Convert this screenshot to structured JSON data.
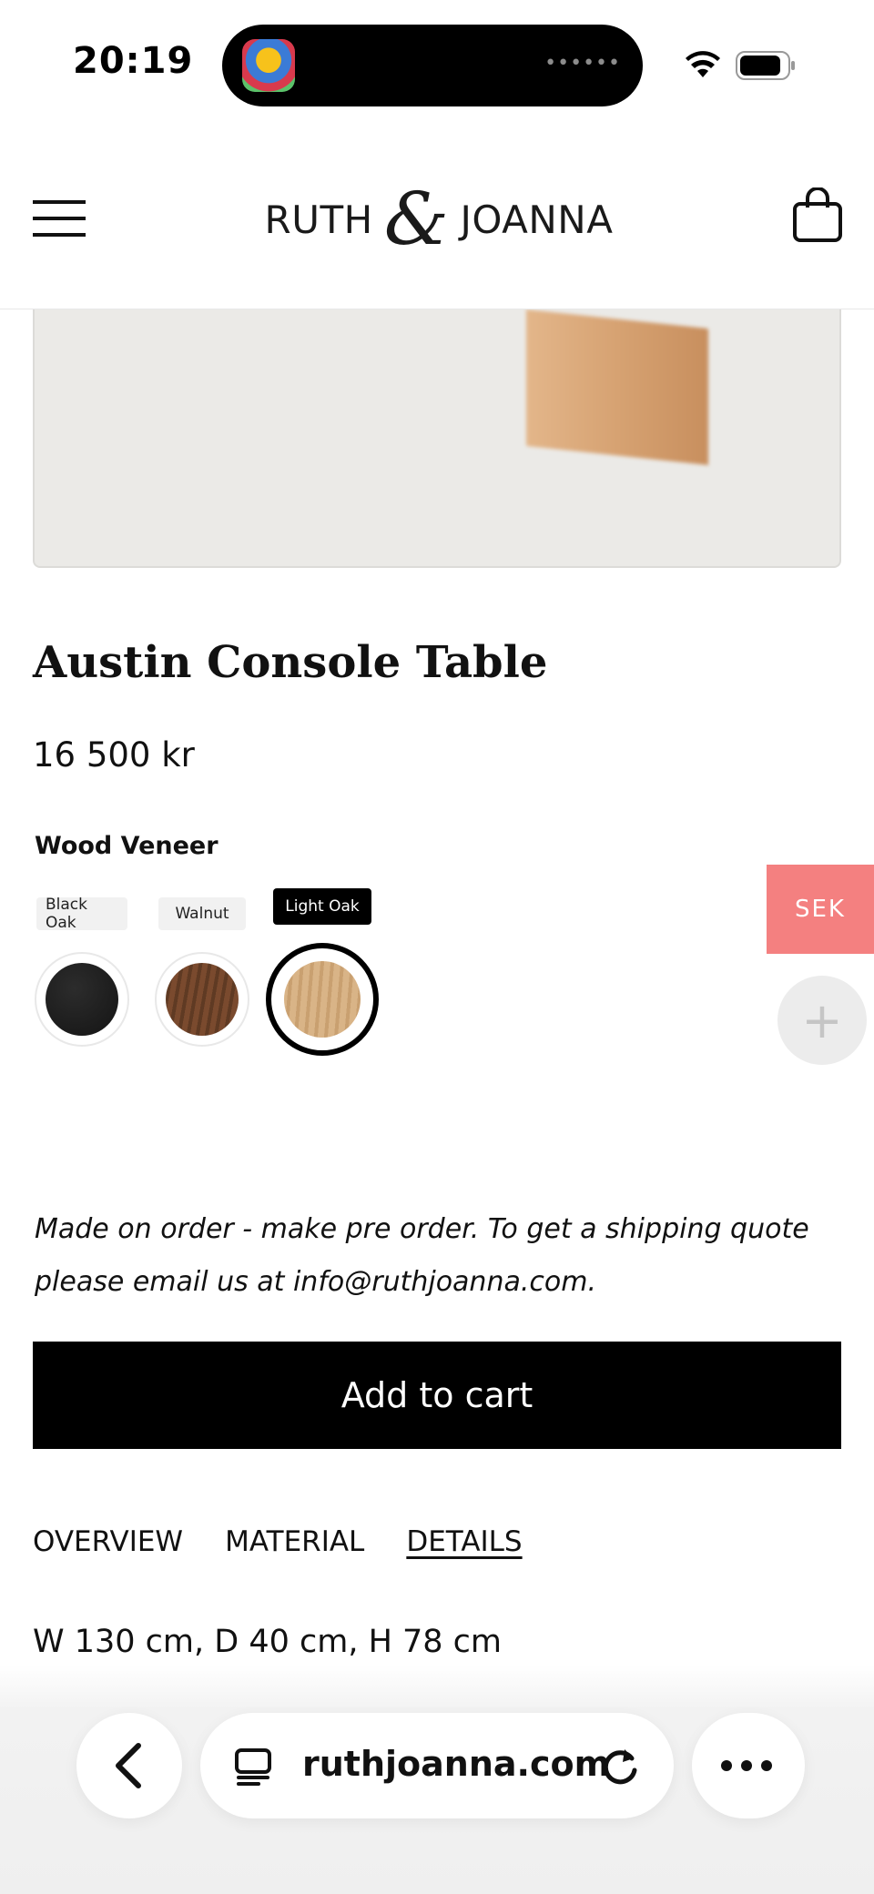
{
  "status_bar": {
    "time": "20:19",
    "island_dots": "••••••",
    "icons": [
      "app-icon",
      "wifi-icon",
      "battery-icon"
    ]
  },
  "header": {
    "logo_left": "RUTH",
    "logo_amp": "&",
    "logo_right": "JOANNA",
    "icons": [
      "hamburger-menu-icon",
      "shopping-bag-icon"
    ]
  },
  "product": {
    "title": "Austin Console Table",
    "price": "16 500 kr",
    "option_label": "Wood Veneer",
    "swatches": [
      {
        "label": "Black Oak",
        "color": "#1f1f1f",
        "selected": false
      },
      {
        "label": "Walnut",
        "color": "#6b4027",
        "selected": false
      },
      {
        "label": "Light Oak",
        "color": "#d2a977",
        "selected": true
      }
    ],
    "note": "Made on order - make pre order. To get a shipping quote please email us at info@ruthjoanna.com.",
    "add_to_cart": "Add to cart"
  },
  "floating": {
    "currency": "SEK",
    "plus": "+",
    "currency_color": "#f48080"
  },
  "tabs": [
    {
      "label": "OVERVIEW",
      "active": false
    },
    {
      "label": "MATERIAL",
      "active": false
    },
    {
      "label": "DETAILS",
      "active": true
    }
  ],
  "details_text": "W 130 cm, D 40 cm, H 78 cm",
  "browser": {
    "address": "ruthjoanna.com",
    "icons": [
      "back-chevron-icon",
      "tabs-icon",
      "reload-icon",
      "more-dots-icon"
    ]
  }
}
